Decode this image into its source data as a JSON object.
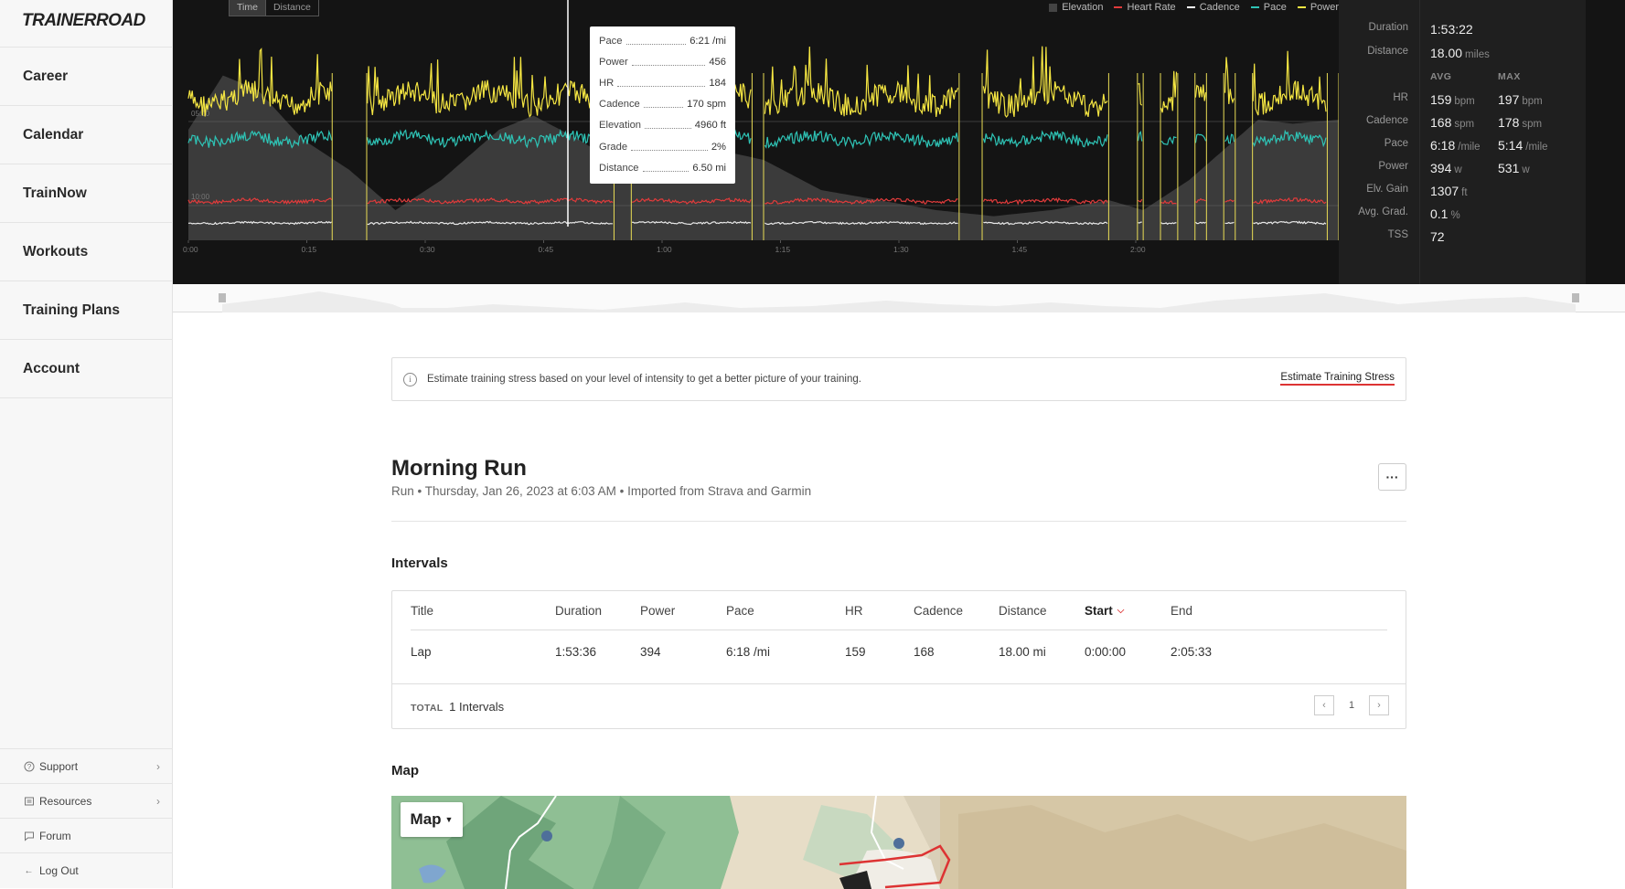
{
  "brand": "TRAINERROAD",
  "nav": [
    "Career",
    "Calendar",
    "TrainNow",
    "Workouts",
    "Training Plans",
    "Account"
  ],
  "side_links": [
    {
      "label": "Support",
      "icon": "question-circle-icon",
      "chevron": true
    },
    {
      "label": "Resources",
      "icon": "book-icon",
      "chevron": true
    },
    {
      "label": "Forum",
      "icon": "chat-icon",
      "chevron": false
    },
    {
      "label": "Log Out",
      "icon": "arrow-left-icon",
      "chevron": false
    }
  ],
  "chart": {
    "toggle": [
      "Time",
      "Distance"
    ],
    "legend": [
      {
        "label": "Elevation",
        "color": "#444444"
      },
      {
        "label": "Heart Rate",
        "color": "#e03b3b"
      },
      {
        "label": "Cadence",
        "color": "#ffffff"
      },
      {
        "label": "Pace",
        "color": "#2ec4b6"
      },
      {
        "label": "Power",
        "color": "#f5e642"
      }
    ],
    "x_ticks": [
      "0:00",
      "0:15",
      "0:30",
      "0:45",
      "1:00",
      "1:15",
      "1:30",
      "1:45",
      "2:00"
    ],
    "y_ticks": [
      "05:00",
      "10:00"
    ],
    "tooltip": [
      {
        "k": "Pace",
        "v": "6:21 /mi"
      },
      {
        "k": "Power",
        "v": "456"
      },
      {
        "k": "HR",
        "v": "184"
      },
      {
        "k": "Cadence",
        "v": "170 spm"
      },
      {
        "k": "Elevation",
        "v": "4960 ft"
      },
      {
        "k": "Grade",
        "v": "2%"
      },
      {
        "k": "Distance",
        "v": "6.50 mi"
      }
    ]
  },
  "stats": {
    "duration_label": "Duration",
    "duration": "1:53:22",
    "distance_label": "Distance",
    "distance": "18.00",
    "distance_unit": "miles",
    "avg_hdr": "AVG",
    "max_hdr": "MAX",
    "rows": [
      {
        "label": "HR",
        "avg": "159",
        "avg_unit": "bpm",
        "max": "197",
        "max_unit": "bpm"
      },
      {
        "label": "Cadence",
        "avg": "168",
        "avg_unit": "spm",
        "max": "178",
        "max_unit": "spm"
      },
      {
        "label": "Pace",
        "avg": "6:18",
        "avg_unit": "/mile",
        "max": "5:14",
        "max_unit": "/mile"
      },
      {
        "label": "Power",
        "avg": "394",
        "avg_unit": "w",
        "max": "531",
        "max_unit": "w"
      },
      {
        "label": "Elv. Gain",
        "avg": "1307",
        "avg_unit": "ft",
        "max": "",
        "max_unit": ""
      },
      {
        "label": "Avg. Grad.",
        "avg": "0.1",
        "avg_unit": "%",
        "max": "",
        "max_unit": ""
      },
      {
        "label": "TSS",
        "avg": "72",
        "avg_unit": "",
        "max": "",
        "max_unit": ""
      }
    ]
  },
  "banner": {
    "text": "Estimate training stress based on your level of intensity to get a better picture of your training.",
    "cta": "Estimate Training Stress"
  },
  "activity": {
    "title": "Morning Run",
    "subtitle": "Run • Thursday, Jan 26, 2023 at 6:03 AM • Imported from Strava and Garmin",
    "more": "···"
  },
  "intervals": {
    "heading": "Intervals",
    "columns": [
      "Title",
      "Duration",
      "Power",
      "Pace",
      "HR",
      "Cadence",
      "Distance",
      "Start",
      "End"
    ],
    "sorted_column": "Start",
    "rows": [
      [
        "Lap",
        "1:53:36",
        "394",
        "6:18 /mi",
        "159",
        "168",
        "18.00 mi",
        "0:00:00",
        "2:05:33"
      ]
    ],
    "total_label": "TOTAL",
    "total_value": "1 Intervals",
    "page": "1"
  },
  "map": {
    "heading": "Map",
    "button": "Map"
  }
}
